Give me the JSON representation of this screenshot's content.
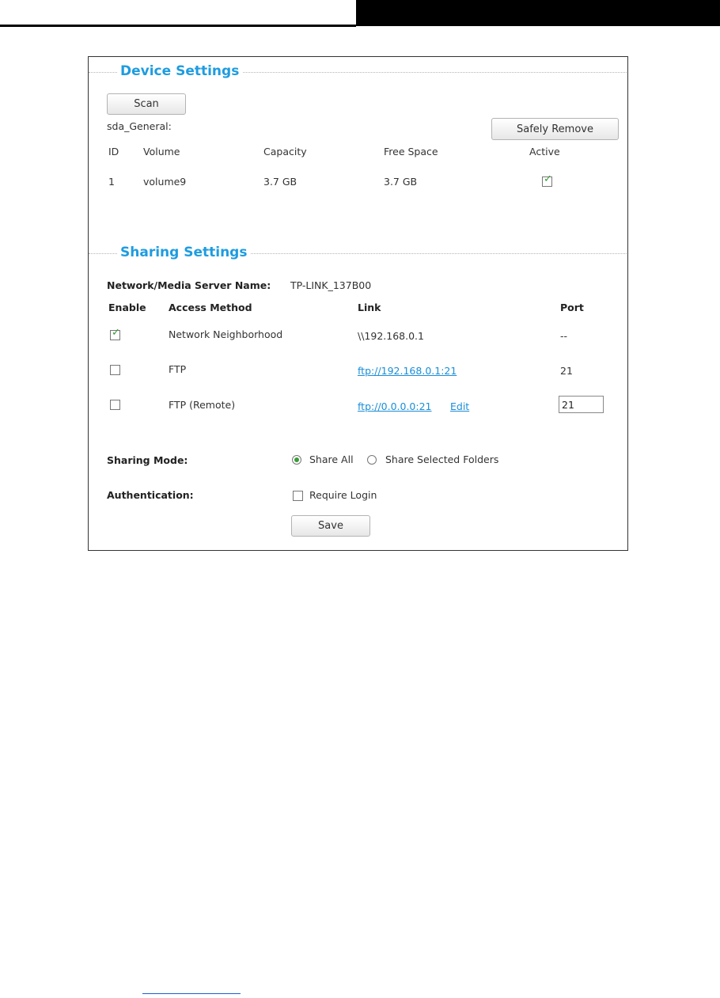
{
  "device_settings": {
    "title": "Device Settings",
    "scan_label": "Scan",
    "disk_name": "sda_General:",
    "safely_remove_label": "Safely Remove",
    "columns": [
      "ID",
      "Volume",
      "Capacity",
      "Free Space",
      "Active"
    ],
    "rows": [
      {
        "id": "1",
        "volume": "volume9",
        "capacity": "3.7 GB",
        "free_space": "3.7 GB",
        "active": true
      }
    ]
  },
  "sharing_settings": {
    "title": "Sharing Settings",
    "server_name_label": "Network/Media Server Name:",
    "server_name_value": "TP-LINK_137B00",
    "columns": {
      "enable": "Enable",
      "access_method": "Access Method",
      "link": "Link",
      "port": "Port"
    },
    "rows": [
      {
        "enabled": true,
        "method": "Network Neighborhood",
        "link": "\\\\192.168.0.1",
        "port": "--"
      },
      {
        "enabled": false,
        "method": "FTP",
        "link": "ftp://192.168.0.1:21",
        "port": "21"
      },
      {
        "enabled": false,
        "method": "FTP (Remote)",
        "link": "ftp://0.0.0.0:21",
        "edit_label": "Edit",
        "port_input": "21"
      }
    ],
    "sharing_mode_label": "Sharing Mode:",
    "sharing_mode_options": [
      "Share All",
      "Share Selected Folders"
    ],
    "sharing_mode_selected": "Share All",
    "authentication_label": "Authentication:",
    "require_login_label": "Require Login",
    "require_login_checked": false,
    "save_label": "Save"
  },
  "colors": {
    "accent": "#1e9ce0",
    "link": "#1a8ed8",
    "check": "#3a9b3a"
  }
}
